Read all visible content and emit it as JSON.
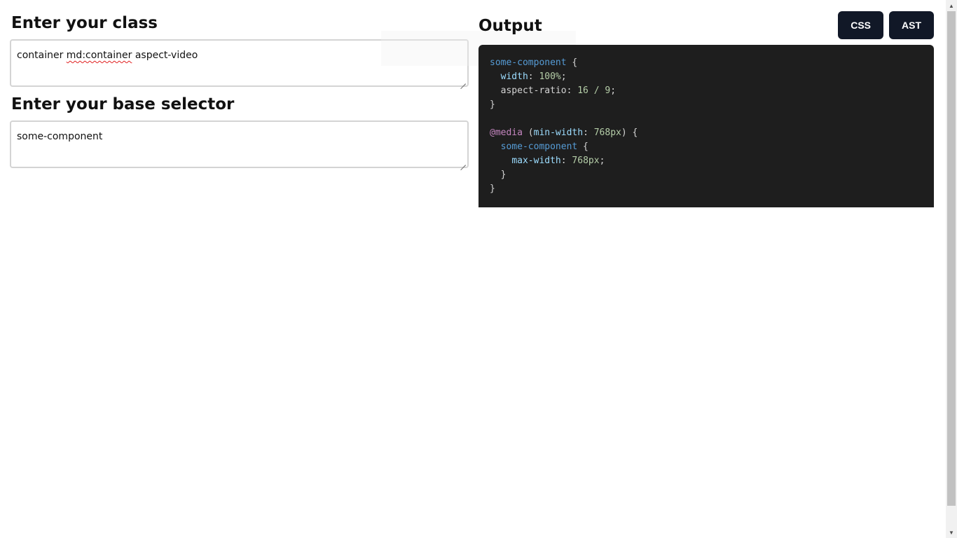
{
  "class_section": {
    "title": "Enter your class",
    "value_parts": [
      "container ",
      "md:container",
      " aspect-video"
    ]
  },
  "selector_section": {
    "title": "Enter your base selector",
    "value": "some-component"
  },
  "output": {
    "title": "Output",
    "buttons": [
      {
        "label": "CSS"
      },
      {
        "label": "AST"
      }
    ],
    "code_tokens": {
      "l1_sel": "some-component",
      "l1_brace": " {",
      "l2_prop": "width",
      "l2_colon": ": ",
      "l2_val": "100%",
      "l2_semi": ";",
      "l3_prop": "aspect-ratio",
      "l3_colon": ": ",
      "l3_val": "16 / 9",
      "l3_semi": ";",
      "l4_close": "}",
      "l6_at": "@media",
      "l6_open": " (",
      "l6_prop": "min-width",
      "l6_colon": ": ",
      "l6_val": "768px",
      "l6_close": ") {",
      "l7_sel": "some-component",
      "l7_brace": " {",
      "l8_prop": "max-width",
      "l8_colon": ": ",
      "l8_val": "768px",
      "l8_semi": ";",
      "l9_close": "}",
      "l10_close": "}"
    }
  },
  "icons": {
    "scroll_up": "▲",
    "scroll_down": "▼"
  }
}
